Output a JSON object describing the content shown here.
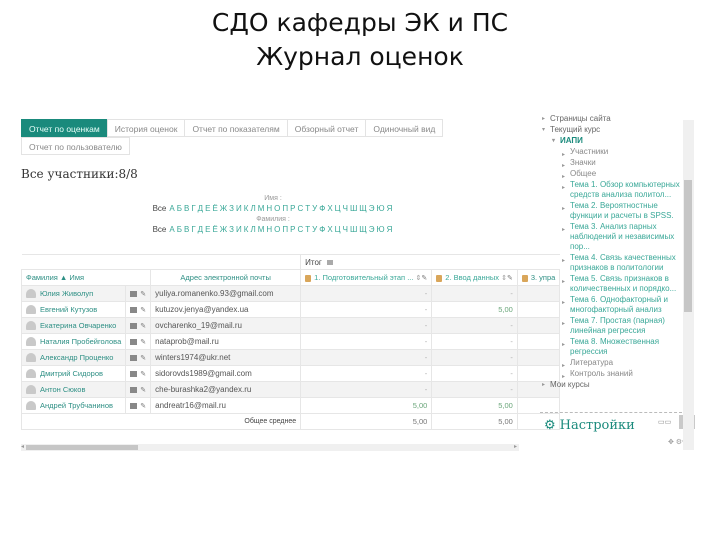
{
  "slide": {
    "title_line1": "СДО кафедры ЭК и ПС",
    "title_line2": "Журнал оценок"
  },
  "tabs": [
    {
      "label": "Отчет по оценкам",
      "active": true
    },
    {
      "label": "История оценок",
      "active": false
    },
    {
      "label": "Отчет по показателям",
      "active": false
    },
    {
      "label": "Обзорный отчет",
      "active": false
    },
    {
      "label": "Одиночный вид",
      "active": false
    },
    {
      "label": "Отчет по пользователю",
      "active": false
    }
  ],
  "participants_label": "Все участники:8/8",
  "initials_filter": {
    "first_name_label": "Имя :",
    "last_name_label": "Фамилия :",
    "all_label": "Все",
    "first_name_letters": [
      "А",
      "Б",
      "В",
      "Г",
      "Д",
      "Е",
      "Ё",
      "Ж",
      "З",
      "И",
      "К",
      "Л",
      "М",
      "Н",
      "О",
      "П",
      "Р",
      "С",
      "Т",
      "У",
      "Ф",
      "Х",
      "Ц",
      "Ч",
      "Ш",
      "Щ",
      "Э",
      "Ю",
      "Я"
    ],
    "last_name_letters": [
      "А",
      "Б",
      "В",
      "Г",
      "Д",
      "Е",
      "Ё",
      "Ж",
      "З",
      "И",
      "К",
      "Л",
      "М",
      "Н",
      "О",
      "П",
      "Р",
      "С",
      "Т",
      "У",
      "Ф",
      "Х",
      "Ц",
      "Ч",
      "Ш",
      "Щ",
      "Э",
      "Ю",
      "Я"
    ]
  },
  "table": {
    "category_header": "Итог",
    "columns": {
      "name": "Фамилия ▲ Имя",
      "email": "Адрес электронной почты",
      "grade1": "1. Подготовительный этап ...",
      "grade2": "2. Ввод данных",
      "grade3": "3. упра"
    },
    "rows": [
      {
        "name": "Юлия Живолуп",
        "email": "yuliya.romanenko.93@gmail.com",
        "g1": "-",
        "g2": "-",
        "g3": ""
      },
      {
        "name": "Евгений Кутузов",
        "email": "kutuzov.jenya@yandex.ua",
        "g1": "-",
        "g2": "5,00",
        "g3": ""
      },
      {
        "name": "Екатерина Овчаренко",
        "email": "ovcharenko_19@mail.ru",
        "g1": "-",
        "g2": "-",
        "g3": ""
      },
      {
        "name": "Наталия Пробейголова",
        "email": "nataprob@mail.ru",
        "g1": "-",
        "g2": "-",
        "g3": ""
      },
      {
        "name": "Александр Проценко",
        "email": "winters1974@ukr.net",
        "g1": "-",
        "g2": "-",
        "g3": ""
      },
      {
        "name": "Дмитрий Сидоров",
        "email": "sidorovds1989@gmail.com",
        "g1": "-",
        "g2": "-",
        "g3": ""
      },
      {
        "name": "Антон Сюков",
        "email": "che-burashka2@yandex.ru",
        "g1": "-",
        "g2": "-",
        "g3": ""
      },
      {
        "name": "Андрей Трубчанинов",
        "email": "andreatr16@mail.ru",
        "g1": "5,00",
        "g2": "5,00",
        "g3": ""
      }
    ],
    "overall_average_label": "Общее среднее",
    "overall_average": {
      "g1": "5,00",
      "g2": "5,00"
    }
  },
  "sidebar": {
    "items": [
      {
        "label": "Страницы сайта",
        "level": 0,
        "arrow": "▸"
      },
      {
        "label": "Текущий курс",
        "level": 0,
        "arrow": "▾"
      },
      {
        "label": "ИАПИ",
        "level": 1,
        "arrow": "▾"
      },
      {
        "label": "Участники",
        "level": 2,
        "arrow": "▸"
      },
      {
        "label": "Значки",
        "level": 2,
        "arrow": "▸"
      },
      {
        "label": "Общее",
        "level": 2,
        "arrow": "▸"
      },
      {
        "label": "Тема 1. Обзор компьютерных средств анализа политол...",
        "level": 2,
        "arrow": "▸",
        "topic": true
      },
      {
        "label": "Тема 2. Вероятностные функции и расчеты в SPSS.",
        "level": 2,
        "arrow": "▸",
        "topic": true
      },
      {
        "label": "Тема 3. Анализ парных наблюдений и независимых пор...",
        "level": 2,
        "arrow": "▸",
        "topic": true
      },
      {
        "label": "Тема 4. Связь качественных признаков в политологии",
        "level": 2,
        "arrow": "▸",
        "topic": true
      },
      {
        "label": "Тема 5. Связь признаков в количественных и порядко...",
        "level": 2,
        "arrow": "▸",
        "topic": true
      },
      {
        "label": "Тема 6. Однофакторный и многофакторный анализ",
        "level": 2,
        "arrow": "▸",
        "topic": true
      },
      {
        "label": "Тема 7. Простая (парная) линейная регрессия",
        "level": 2,
        "arrow": "▸",
        "topic": true
      },
      {
        "label": "Тема 8. Множественная регрессия",
        "level": 2,
        "arrow": "▸",
        "topic": true
      },
      {
        "label": "Литература",
        "level": 2,
        "arrow": "▸"
      },
      {
        "label": "Контроль знаний",
        "level": 2,
        "arrow": "▸"
      },
      {
        "label": "Мои курсы",
        "level": 0,
        "arrow": "▸"
      }
    ],
    "settings_label": "Настройки"
  },
  "colors": {
    "accent": "#1a8a7c",
    "link": "#3aa898",
    "positive_grade": "#6aa67a"
  }
}
